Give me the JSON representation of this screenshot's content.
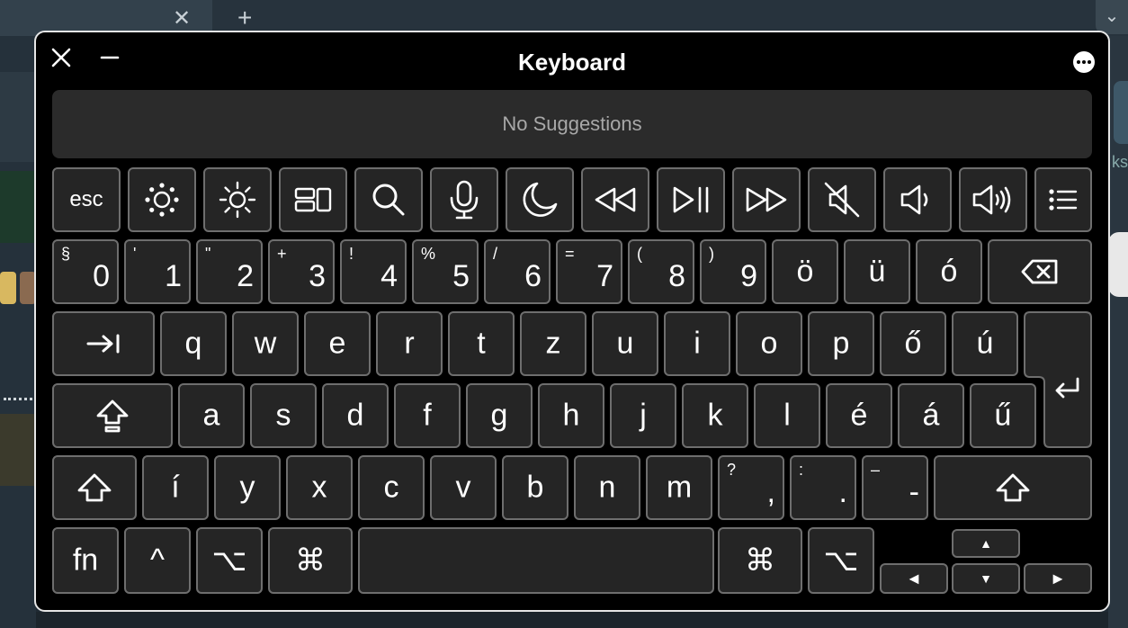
{
  "background": {
    "tab_close_label": "✕",
    "new_tab_label": "+",
    "chevron_label": "⌄",
    "right_partial_text": "ks"
  },
  "window": {
    "title": "Keyboard",
    "close_icon": "close-icon",
    "minimize_icon": "minimize-icon",
    "more_icon": "more-icon"
  },
  "suggestions": {
    "text": "No Suggestions"
  },
  "keys": {
    "esc": "esc",
    "num_row": [
      {
        "shift": "§",
        "main": "0"
      },
      {
        "shift": "'",
        "main": "1"
      },
      {
        "shift": "\"",
        "main": "2"
      },
      {
        "shift": "+",
        "main": "3"
      },
      {
        "shift": "!",
        "main": "4"
      },
      {
        "shift": "%",
        "main": "5"
      },
      {
        "shift": "/",
        "main": "6"
      },
      {
        "shift": "=",
        "main": "7"
      },
      {
        "shift": "(",
        "main": "8"
      },
      {
        "shift": ")",
        "main": "9"
      },
      {
        "shift": "",
        "main": "ö"
      },
      {
        "shift": "",
        "main": "ü"
      },
      {
        "shift": "",
        "main": "ó"
      }
    ],
    "q_row": [
      "q",
      "w",
      "e",
      "r",
      "t",
      "z",
      "u",
      "i",
      "o",
      "p",
      "ő",
      "ú"
    ],
    "a_row": [
      "a",
      "s",
      "d",
      "f",
      "g",
      "h",
      "j",
      "k",
      "l",
      "é",
      "á",
      "ű"
    ],
    "y_row": [
      "í",
      "y",
      "x",
      "c",
      "v",
      "b",
      "n",
      "m"
    ],
    "comma": {
      "shift": "?",
      "main": ","
    },
    "period": {
      "shift": ":",
      "main": "."
    },
    "dash": {
      "shift": "–",
      "main": "-"
    },
    "fn": "fn",
    "ctrl": "^",
    "option": "⌥",
    "command": "⌘",
    "arrow_up": "▲",
    "arrow_left": "◀",
    "arrow_down": "▼",
    "arrow_right": "▶"
  },
  "icons": {
    "function_row": [
      "brightness-down-icon",
      "brightness-up-icon",
      "mission-control-icon",
      "search-icon",
      "microphone-icon",
      "do-not-disturb-icon",
      "rewind-icon",
      "play-pause-icon",
      "fast-forward-icon",
      "mute-icon",
      "volume-down-icon",
      "volume-up-icon",
      "list-icon"
    ],
    "delete": "delete-icon",
    "tab": "tab-icon",
    "return": "return-icon",
    "caps_lock": "caps-lock-icon",
    "shift": "shift-icon"
  }
}
